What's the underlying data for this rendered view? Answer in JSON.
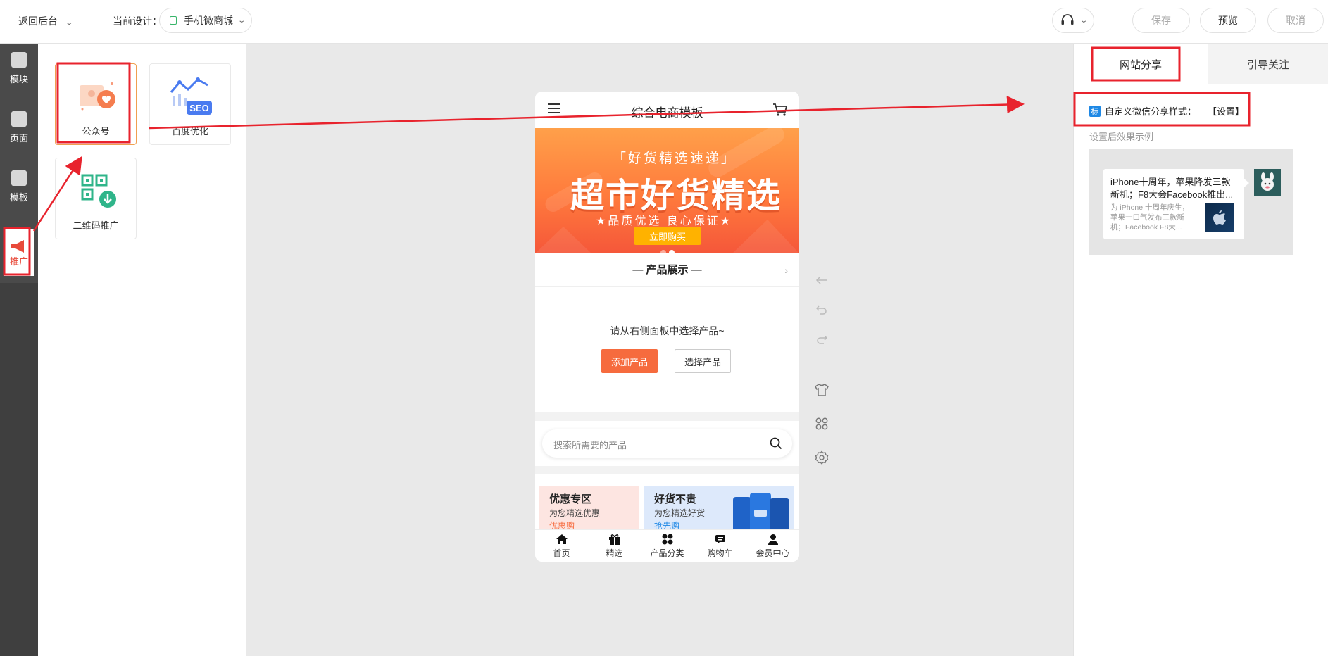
{
  "topbar": {
    "back_label": "返回后台",
    "design_label": "当前设计：",
    "design_value": "手机微商城",
    "save_label": "保存",
    "preview_label": "预览",
    "cancel_label": "取消"
  },
  "leftnav": {
    "items": [
      {
        "label": "模块",
        "icon": "module-icon"
      },
      {
        "label": "页面",
        "icon": "page-icon"
      },
      {
        "label": "模板",
        "icon": "template-icon"
      },
      {
        "label": "推广",
        "icon": "megaphone-icon"
      }
    ]
  },
  "panel": {
    "cards": [
      {
        "label": "公众号",
        "icon": "wechat-official-icon"
      },
      {
        "label": "百度优化",
        "icon": "seo-icon",
        "badge": "SEO"
      },
      {
        "label": "二维码推广",
        "icon": "qrcode-icon"
      }
    ]
  },
  "phone": {
    "title": "综合电商模板",
    "banner": {
      "subtitle": "「好货精选速递」",
      "headline": "超市好货精选",
      "tagline": "★品质优选 良心保证★",
      "button": "立即购买"
    },
    "section_title": "— 产品展示 —",
    "empty_message": "请从右侧面板中选择产品~",
    "add_product": "添加产品",
    "choose_product": "选择产品",
    "search_placeholder": "搜索所需要的产品",
    "promos": [
      {
        "title": "优惠专区",
        "subtitle": "为您精选优惠",
        "link": "优惠购"
      },
      {
        "title": "好货不贵",
        "subtitle": "为您精选好货",
        "link": "抢先购"
      }
    ],
    "bottom_nav": [
      {
        "label": "首页",
        "icon": "home-icon"
      },
      {
        "label": "精选",
        "icon": "gift-icon"
      },
      {
        "label": "产品分类",
        "icon": "category-icon"
      },
      {
        "label": "购物车",
        "icon": "cart-icon"
      },
      {
        "label": "会员中心",
        "icon": "user-icon"
      }
    ]
  },
  "tools": [
    {
      "icon": "back-arrow-icon"
    },
    {
      "icon": "undo-icon"
    },
    {
      "icon": "redo-icon"
    },
    {
      "icon": "shirt-icon"
    },
    {
      "icon": "grid-icon"
    },
    {
      "icon": "settings-icon"
    }
  ],
  "rpanel": {
    "tab_share": "网站分享",
    "tab_follow": "引导关注",
    "badge": "标",
    "custom_share_label": "自定义微信分享样式：",
    "setting_link": "【设置】",
    "hint": "设置后效果示例",
    "share_title": "iPhone十周年，苹果降发三款新机；F8大会Facebook推出...",
    "share_desc": "为 iPhone 十周年庆生，苹果一口气发布三款新机；Facebook F8大..."
  },
  "colors": {
    "accent": "#f66b3e",
    "annotation": "#e8232d",
    "link_blue": "#1e88e5"
  }
}
